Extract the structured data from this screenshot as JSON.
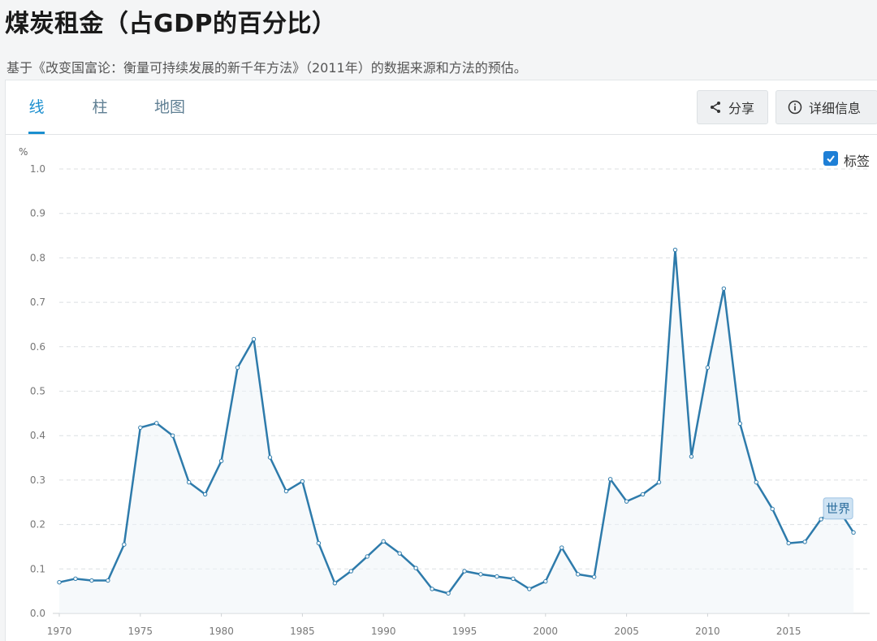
{
  "header": {
    "title": "煤炭租金（占GDP的百分比）",
    "subtitle": "基于《改变国富论：衡量可持续发展的新千年方法》（2011年）的数据来源和方法的预估。"
  },
  "tabs": [
    {
      "label": "线",
      "active": true
    },
    {
      "label": "柱",
      "active": false
    },
    {
      "label": "地图",
      "active": false
    }
  ],
  "toolbar": {
    "share_label": "分享",
    "details_label": "详细信息",
    "share_icon": "share-icon",
    "details_icon": "info-icon"
  },
  "legend": {
    "label": "标签",
    "checked": true
  },
  "colors": {
    "accent": "#1b8fcf",
    "line": "#2e7bab",
    "checkbox": "#1e7fd6"
  },
  "chart_data": {
    "type": "line",
    "ylabel": "%",
    "ylim": [
      0,
      1.0
    ],
    "yticks": [
      "0.0",
      "0.1",
      "0.2",
      "0.3",
      "0.4",
      "0.5",
      "0.6",
      "0.7",
      "0.8",
      "0.9",
      "1.0"
    ],
    "xlim": [
      1970,
      2020
    ],
    "xticks": [
      "1970",
      "1975",
      "1980",
      "1985",
      "1990",
      "1995",
      "2000",
      "2005",
      "2010",
      "2015"
    ],
    "grid": true,
    "series": [
      {
        "name": "世界",
        "x": [
          1970,
          1971,
          1972,
          1973,
          1974,
          1975,
          1976,
          1977,
          1978,
          1979,
          1980,
          1981,
          1982,
          1983,
          1984,
          1985,
          1986,
          1987,
          1988,
          1989,
          1990,
          1991,
          1992,
          1993,
          1994,
          1995,
          1996,
          1997,
          1998,
          1999,
          2000,
          2001,
          2002,
          2003,
          2004,
          2005,
          2006,
          2007,
          2008,
          2009,
          2010,
          2011,
          2012,
          2013,
          2014,
          2015,
          2016,
          2017,
          2018,
          2019
        ],
        "y": [
          0.07,
          0.078,
          0.074,
          0.074,
          0.155,
          0.418,
          0.428,
          0.4,
          0.295,
          0.268,
          0.343,
          0.553,
          0.617,
          0.351,
          0.275,
          0.297,
          0.158,
          0.068,
          0.095,
          0.128,
          0.162,
          0.135,
          0.102,
          0.055,
          0.045,
          0.095,
          0.088,
          0.083,
          0.078,
          0.055,
          0.072,
          0.148,
          0.088,
          0.082,
          0.302,
          0.252,
          0.268,
          0.295,
          0.818,
          0.353,
          0.553,
          0.731,
          0.427,
          0.295,
          0.235,
          0.158,
          0.161,
          0.212,
          0.238,
          0.182
        ]
      }
    ]
  }
}
